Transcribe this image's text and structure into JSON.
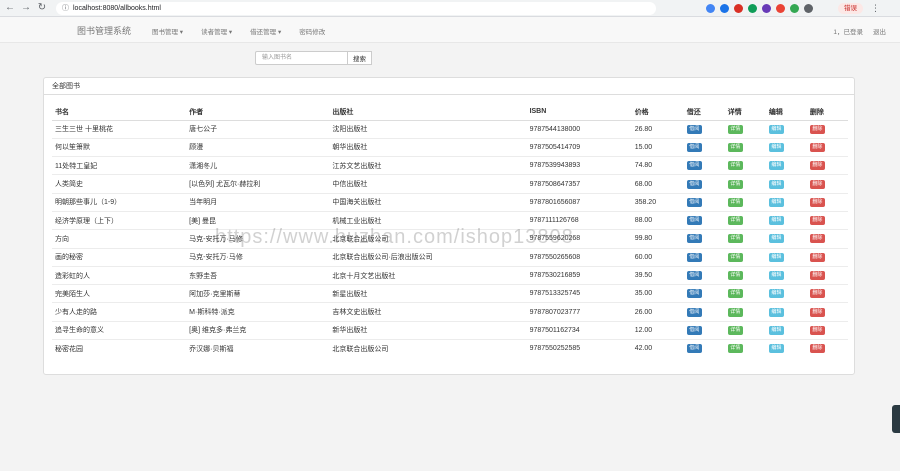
{
  "browser": {
    "url": "localhost:8080/allbooks.html",
    "profile_label": "错误"
  },
  "navbar": {
    "brand": "图书管理系统",
    "menus": [
      "图书管理 ▾",
      "读者管理 ▾",
      "借还管理 ▾",
      "密码修改"
    ],
    "user": "1，已登录",
    "logout": "退出"
  },
  "search": {
    "placeholder": "输入图书名",
    "button": "搜索"
  },
  "panel": {
    "title": "全部图书"
  },
  "table": {
    "headers": [
      "书名",
      "作者",
      "出版社",
      "ISBN",
      "价格",
      "借还",
      "详情",
      "编辑",
      "删除"
    ],
    "action_labels": {
      "borrow": "借阅",
      "detail": "详情",
      "edit": "编辑",
      "delete": "删除"
    },
    "rows": [
      {
        "name": "三生三世 十里桃花",
        "author": "唐七公子",
        "pub": "沈阳出版社",
        "isbn": "9787544138000",
        "price": "26.80"
      },
      {
        "name": "何以笙箫默",
        "author": "顾漫",
        "pub": "朝华出版社",
        "isbn": "9787505414709",
        "price": "15.00"
      },
      {
        "name": "11处特工皇妃",
        "author": "潇湘冬儿",
        "pub": "江苏文艺出版社",
        "isbn": "9787539943893",
        "price": "74.80"
      },
      {
        "name": "人类简史",
        "author": "[以色列] 尤瓦尔·赫拉利",
        "pub": "中信出版社",
        "isbn": "9787508647357",
        "price": "68.00"
      },
      {
        "name": "明朝那些事儿（1-9）",
        "author": "当年明月",
        "pub": "中国海关出版社",
        "isbn": "9787801656087",
        "price": "358.20"
      },
      {
        "name": "经济学原理（上下）",
        "author": "[美] 曼昆",
        "pub": "机械工业出版社",
        "isbn": "9787111126768",
        "price": "88.00"
      },
      {
        "name": "方向",
        "author": "马克-安托万·马修",
        "pub": "北京联合出版公司",
        "isbn": "9787559620268",
        "price": "99.80"
      },
      {
        "name": "画的秘密",
        "author": "马克-安托万·马修",
        "pub": "北京联合出版公司·后浪出版公司",
        "isbn": "9787550265608",
        "price": "60.00"
      },
      {
        "name": "造彩虹的人",
        "author": "东野圭吾",
        "pub": "北京十月文艺出版社",
        "isbn": "9787530216859",
        "price": "39.50"
      },
      {
        "name": "完美陌生人",
        "author": "阿加莎·克里斯蒂",
        "pub": "新星出版社",
        "isbn": "9787513325745",
        "price": "35.00"
      },
      {
        "name": "少有人走的路",
        "author": "M·斯科特·派克",
        "pub": "吉林文史出版社",
        "isbn": "9787807023777",
        "price": "26.00"
      },
      {
        "name": "追寻生命的意义",
        "author": "[奥] 维克多·弗兰克",
        "pub": "新华出版社",
        "isbn": "9787501162734",
        "price": "12.00"
      },
      {
        "name": "秘密花园",
        "author": "乔汉娜·贝斯福",
        "pub": "北京联合出版公司",
        "isbn": "9787550252585",
        "price": "42.00"
      }
    ]
  },
  "watermark": "https://www.huzhan.com/ishop13808",
  "colors": {
    "primary": "#337ab7",
    "success": "#5cb85c",
    "info": "#5bc0de",
    "danger": "#d9534f"
  }
}
